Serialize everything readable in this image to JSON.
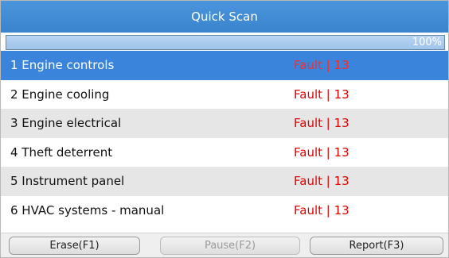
{
  "header": {
    "title": "Quick Scan"
  },
  "progress": {
    "value": 100,
    "label": "100%"
  },
  "systems": [
    {
      "name": "1 Engine controls",
      "status": "Fault | 13"
    },
    {
      "name": "2 Engine cooling",
      "status": "Fault | 13"
    },
    {
      "name": "3 Engine electrical",
      "status": "Fault | 13"
    },
    {
      "name": "4 Theft deterrent",
      "status": "Fault | 13"
    },
    {
      "name": "5 Instrument panel",
      "status": "Fault | 13"
    },
    {
      "name": "6 HVAC systems - manual",
      "status": "Fault | 13"
    }
  ],
  "footer": {
    "erase_label": "Erase(F1)",
    "pause_label": "Pause(F2)",
    "report_label": "Report(F3)"
  },
  "colors": {
    "accent": "#3a84db",
    "fault": "#e00000"
  }
}
